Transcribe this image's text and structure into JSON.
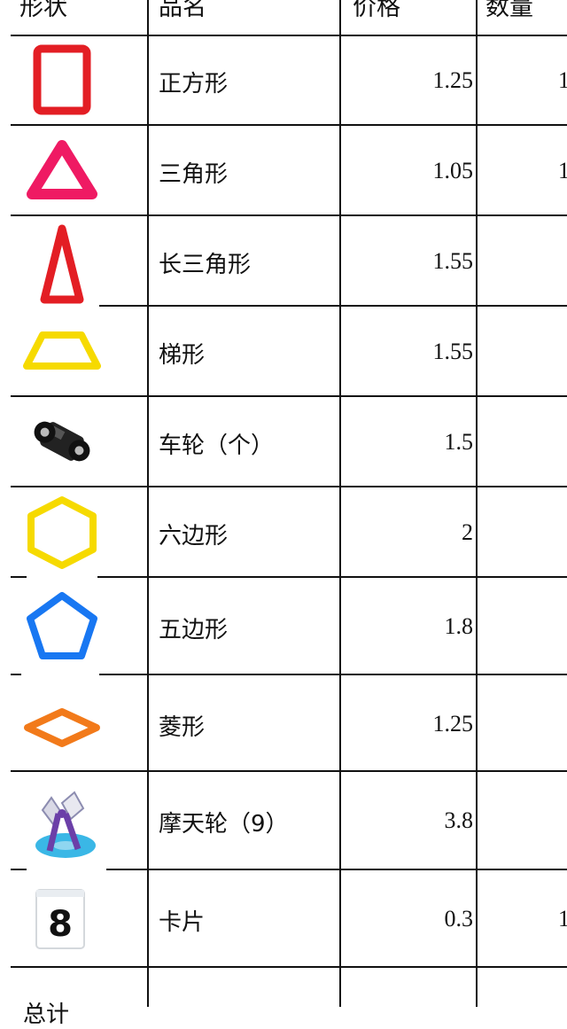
{
  "table": {
    "headers": {
      "shape": "形状",
      "name": "品名",
      "price": "价格",
      "quantity": "数量"
    },
    "rows": [
      {
        "name": "正方形",
        "price": "1.25",
        "qty": "1",
        "icon": "red-square-frame-icon",
        "color": "#e31e24"
      },
      {
        "name": "三角形",
        "price": "1.05",
        "qty": "1",
        "icon": "pink-triangle-frame-icon",
        "color": "#ef1a63"
      },
      {
        "name": "长三角形",
        "price": "1.55",
        "qty": "",
        "icon": "red-tall-triangle-frame-icon",
        "color": "#e31e24"
      },
      {
        "name": "梯形",
        "price": "1.55",
        "qty": "",
        "icon": "yellow-trapezoid-frame-icon",
        "color": "#f6da00"
      },
      {
        "name": "车轮（个）",
        "price": "1.5",
        "qty": "",
        "icon": "black-wheel-base-icon",
        "color": "#1a1a1a"
      },
      {
        "name": "六边形",
        "price": "2",
        "qty": "",
        "icon": "yellow-hexagon-frame-icon",
        "color": "#f6da00"
      },
      {
        "name": "五边形",
        "price": "1.8",
        "qty": "",
        "icon": "blue-pentagon-frame-icon",
        "color": "#1877f2"
      },
      {
        "name": "菱形",
        "price": "1.25",
        "qty": "",
        "icon": "orange-rhombus-frame-icon",
        "color": "#f27a1a"
      },
      {
        "name": "摩天轮（9）",
        "price": "3.8",
        "qty": "",
        "icon": "ferris-wheel-kit-icon",
        "color": "#3ab7e6"
      },
      {
        "name": "卡片",
        "price": "0.3",
        "qty": "1",
        "icon": "number-card-8-icon",
        "color": "#111111"
      }
    ],
    "footer_label": "总计"
  }
}
